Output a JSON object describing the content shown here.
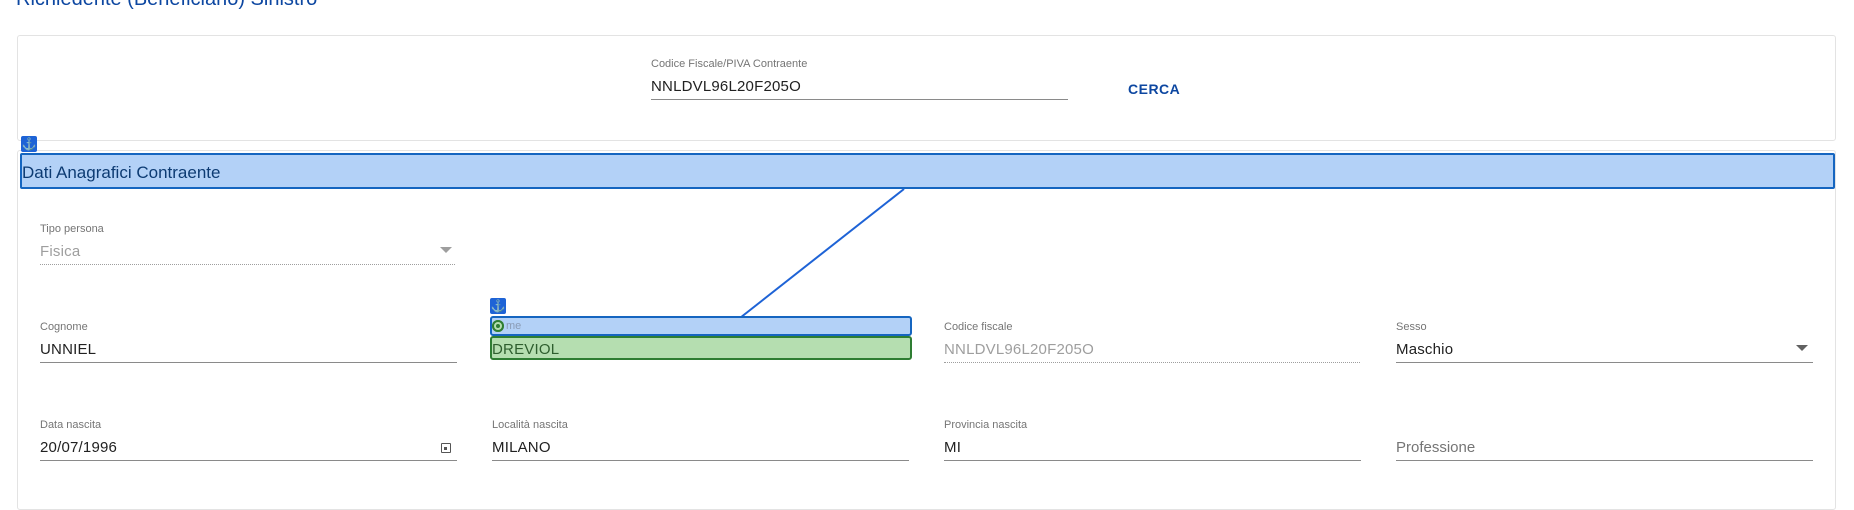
{
  "page": {
    "heading": "Richiedente (Beneficiario) Sinistro"
  },
  "search": {
    "label": "Codice Fiscale/PIVA Contraente",
    "value": "NNLDVL96L20F205O",
    "button_label": "CERCA"
  },
  "section": {
    "title": "Dati Anagrafici Contraente",
    "anchor_icon": "anchor-icon"
  },
  "fields": {
    "tipo_persona": {
      "label": "Tipo persona",
      "value": "Fisica"
    },
    "cognome": {
      "label": "Cognome",
      "value": "UNNIEL"
    },
    "nome": {
      "label": "me",
      "value": "DREVIOL"
    },
    "codice_fiscale": {
      "label": "Codice fiscale",
      "value": "NNLDVL96L20F205O"
    },
    "sesso": {
      "label": "Sesso",
      "value": "Maschio"
    },
    "data_nascita": {
      "label": "Data nascita",
      "value": "20/07/1996"
    },
    "localita_nascita": {
      "label": "Località nascita",
      "value": "MILANO"
    },
    "provincia_nascita": {
      "label": "Provincia nascita",
      "value": "MI"
    },
    "professione": {
      "placeholder": "Professione"
    }
  },
  "colors": {
    "accent": "#0d47a1",
    "highlight_blue": "#b3d1f7",
    "highlight_blue_border": "#1565c0",
    "highlight_green": "#b5deb0",
    "highlight_green_border": "#2e7d32"
  }
}
